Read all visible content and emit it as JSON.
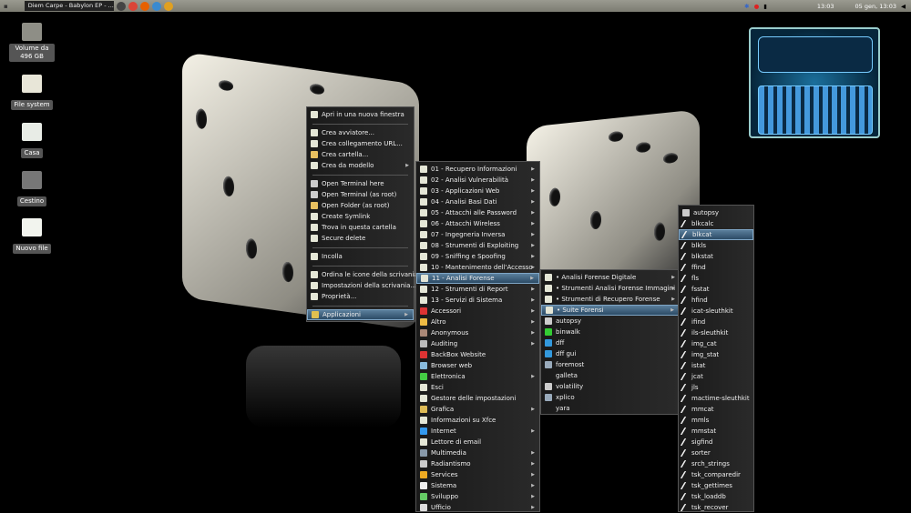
{
  "panel": {
    "task_title": "Diem Carpe - Babylon EP - ...",
    "time": "13:03",
    "date_time": "05 gen, 13:03",
    "launchers": [
      {
        "icon": "terminal-icon",
        "color": "#444"
      },
      {
        "icon": "chrome-icon",
        "color": "#db4437"
      },
      {
        "icon": "firefox-icon",
        "color": "#e66000"
      },
      {
        "icon": "network-icon",
        "color": "#3a8ad0"
      },
      {
        "icon": "games-icon",
        "color": "#e0a020"
      }
    ]
  },
  "desktop": {
    "icons": [
      {
        "label": "Volume da 496 GB",
        "icon": "drive-icon",
        "color": "#8e8e86"
      },
      {
        "label": "File system",
        "icon": "drive-icon",
        "color": "#e8e6d8"
      },
      {
        "label": "Casa",
        "icon": "home-folder-icon",
        "color": "#e8ece6"
      },
      {
        "label": "Cestino",
        "icon": "trash-icon",
        "color": "#777"
      },
      {
        "label": "Nuovo file",
        "icon": "file-icon",
        "color": "#f2f4ee"
      }
    ]
  },
  "menus": [
    {
      "id": "desktop-menu",
      "items": [
        {
          "label": "Apri in una nuova finestra",
          "icon": "open-icon"
        },
        {
          "sep": true
        },
        {
          "label": "Crea avviatore...",
          "icon": "launcher-icon"
        },
        {
          "label": "Crea collegamento URL...",
          "icon": "link-icon"
        },
        {
          "label": "Crea cartella...",
          "icon": "folder-icon"
        },
        {
          "label": "Crea da modello",
          "sub": true
        },
        {
          "sep": true
        },
        {
          "label": "Open Terminal here",
          "icon": "terminal-icon"
        },
        {
          "label": "Open Terminal (as root)",
          "icon": "terminal-icon"
        },
        {
          "label": "Open Folder (as root)",
          "icon": "folder-icon"
        },
        {
          "label": "Create Symlink",
          "icon": "symlink-icon"
        },
        {
          "label": "Trova in questa cartella",
          "icon": "search-icon"
        },
        {
          "label": "Secure delete",
          "icon": "file-icon"
        },
        {
          "sep": true
        },
        {
          "label": "Incolla",
          "icon": "paste-icon"
        },
        {
          "sep": true
        },
        {
          "label": "Ordina le icone della scrivania",
          "icon": "sort-icon"
        },
        {
          "label": "Impostazioni della scrivania...",
          "icon": "settings-icon"
        },
        {
          "label": "Proprietà...",
          "icon": "properties-icon"
        },
        {
          "sep": true
        },
        {
          "label": "Applicazioni",
          "icon": "applications-icon",
          "sub": true,
          "hl": true
        }
      ]
    },
    {
      "id": "applications-menu",
      "items": [
        {
          "label": "01 - Recupero Informazioni",
          "sub": true
        },
        {
          "label": "02 - Analisi Vulnerabilità",
          "sub": true
        },
        {
          "label": "03 - Applicazioni Web",
          "sub": true
        },
        {
          "label": "04 - Analisi Basi Dati",
          "sub": true
        },
        {
          "label": "05 - Attacchi alle Password",
          "sub": true
        },
        {
          "label": "06 - Attacchi Wireless",
          "sub": true
        },
        {
          "label": "07 - Ingegneria Inversa",
          "sub": true
        },
        {
          "label": "08 - Strumenti di Exploiting",
          "sub": true
        },
        {
          "label": "09 - Sniffing e Spoofing",
          "sub": true
        },
        {
          "label": "10 - Mantenimento dell'Accesso",
          "sub": true
        },
        {
          "label": "11 - Analisi Forense",
          "sub": true,
          "hl": true
        },
        {
          "label": "12 - Strumenti di Report",
          "sub": true
        },
        {
          "label": "13 - Servizi di Sistema",
          "sub": true
        },
        {
          "label": "Accessori",
          "icon": "accessories-icon",
          "sub": true
        },
        {
          "label": "Altro",
          "icon": "other-icon",
          "sub": true
        },
        {
          "label": "Anonymous",
          "icon": "anonymous-icon",
          "sub": true
        },
        {
          "label": "Auditing",
          "icon": "auditing-icon",
          "sub": true
        },
        {
          "label": "BackBox Website",
          "icon": "website-icon"
        },
        {
          "label": "Browser web",
          "icon": "browser-icon"
        },
        {
          "label": "Elettronica",
          "icon": "electronics-icon",
          "sub": true
        },
        {
          "label": "Esci",
          "icon": "logout-icon"
        },
        {
          "label": "Gestore delle impostazioni",
          "icon": "settings-icon"
        },
        {
          "label": "Grafica",
          "icon": "graphics-icon",
          "sub": true
        },
        {
          "label": "Informazioni su Xfce",
          "icon": "info-icon"
        },
        {
          "label": "Internet",
          "icon": "internet-icon",
          "sub": true
        },
        {
          "label": "Lettore di email",
          "icon": "email-icon"
        },
        {
          "label": "Multimedia",
          "icon": "multimedia-icon",
          "sub": true
        },
        {
          "label": "Radiantismo",
          "icon": "radio-icon",
          "sub": true
        },
        {
          "label": "Services",
          "icon": "services-icon",
          "sub": true
        },
        {
          "label": "Sistema",
          "icon": "system-icon",
          "sub": true
        },
        {
          "label": "Sviluppo",
          "icon": "development-icon",
          "sub": true
        },
        {
          "label": "Ufficio",
          "icon": "office-icon",
          "sub": true
        }
      ]
    },
    {
      "id": "forensics-menu",
      "items": [
        {
          "label": "• Analisi Forense Digitale",
          "sub": true
        },
        {
          "label": "• Strumenti Analisi Forense Immagini",
          "sub": true
        },
        {
          "label": "• Strumenti di Recupero Forense",
          "sub": true
        },
        {
          "label": "• Suite Forensi",
          "sub": true,
          "hl": true
        },
        {
          "label": "autopsy",
          "icon": "autopsy-icon"
        },
        {
          "label": "binwalk",
          "icon": "binwalk-icon"
        },
        {
          "label": "dff",
          "icon": "dff-icon"
        },
        {
          "label": "dff gui",
          "icon": "dff-icon"
        },
        {
          "label": "foremost",
          "icon": "foremost-icon"
        },
        {
          "label": "galleta"
        },
        {
          "label": "volatility",
          "icon": "volatility-icon"
        },
        {
          "label": "xplico",
          "icon": "xplico-icon"
        },
        {
          "label": "yara"
        }
      ]
    },
    {
      "id": "suite-forensi-menu",
      "items": [
        {
          "label": "autopsy",
          "icon": "autopsy-icon"
        },
        {
          "label": "blkcalc"
        },
        {
          "label": "blkcat",
          "hl": true
        },
        {
          "label": "blkls"
        },
        {
          "label": "blkstat"
        },
        {
          "label": "ffind"
        },
        {
          "label": "fls"
        },
        {
          "label": "fsstat"
        },
        {
          "label": "hfind"
        },
        {
          "label": "icat-sleuthkit"
        },
        {
          "label": "ifind"
        },
        {
          "label": "ils-sleuthkit"
        },
        {
          "label": "img_cat"
        },
        {
          "label": "img_stat"
        },
        {
          "label": "istat"
        },
        {
          "label": "jcat"
        },
        {
          "label": "jls"
        },
        {
          "label": "mactime-sleuthkit"
        },
        {
          "label": "mmcat"
        },
        {
          "label": "mmls"
        },
        {
          "label": "mmstat"
        },
        {
          "label": "sigfind"
        },
        {
          "label": "sorter"
        },
        {
          "label": "srch_strings"
        },
        {
          "label": "tsk_comparedir"
        },
        {
          "label": "tsk_gettimes"
        },
        {
          "label": "tsk_loaddb"
        },
        {
          "label": "tsk_recover"
        }
      ]
    }
  ],
  "colors": {
    "highlight": "#3f6584",
    "folder_icon": "#e4e6d6",
    "tool_icon": "#e8e8e8"
  }
}
